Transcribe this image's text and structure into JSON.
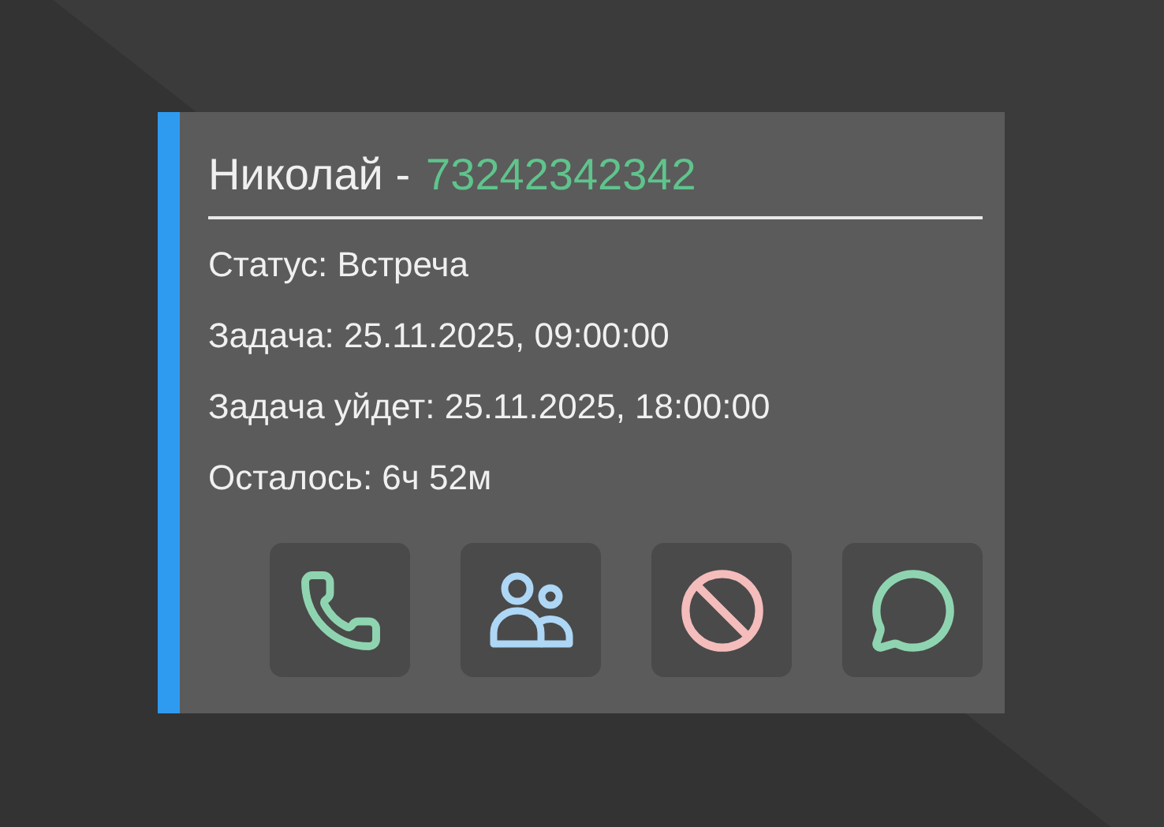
{
  "card": {
    "name": "Николай -",
    "phone": "73242342342",
    "lines": [
      "Статус: Встреча",
      "Задача: 25.11.2025, 09:00:00",
      "Задача уйдет: 25.11.2025, 18:00:00",
      "Осталось: 6ч 52м"
    ],
    "actions": [
      {
        "kind": "phone",
        "color": "#8fd4b0"
      },
      {
        "kind": "people",
        "color": "#aed6f5"
      },
      {
        "kind": "block",
        "color": "#f5bcbc"
      },
      {
        "kind": "chat",
        "color": "#8fd4b0"
      }
    ]
  }
}
